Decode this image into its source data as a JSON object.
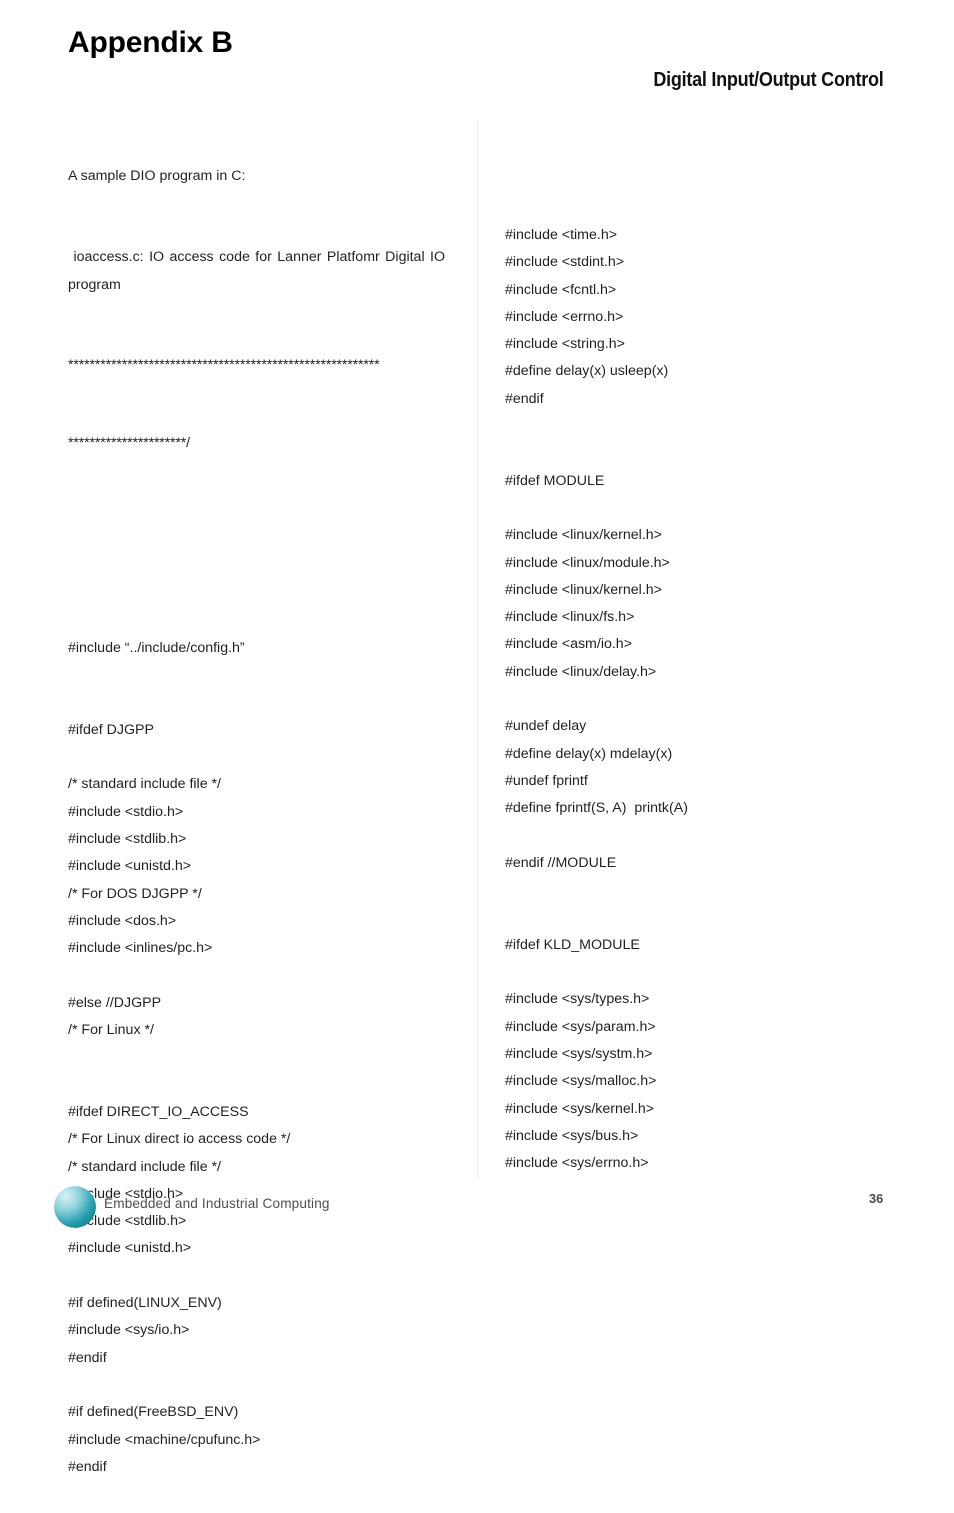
{
  "header": {
    "appendix_title": "Appendix B",
    "section_title": "Digital Input/Output Control"
  },
  "left_column": {
    "intro_line": "A sample DIO program in C:",
    "comment_line": " ioaccess.c: IO access code for Lanner Platfomr Digital IO program",
    "stars_line_1": "**********************************************************",
    "stars_line_2": "**********************/",
    "code_lines": [
      "#include “../include/config.h”",
      "",
      "",
      "#ifdef DJGPP",
      "",
      "/* standard include file */",
      "#include <stdio.h>",
      "#include <stdlib.h>",
      "#include <unistd.h>",
      "/* For DOS DJGPP */",
      "#include <dos.h>",
      "#include <inlines/pc.h>",
      "",
      "#else //DJGPP",
      "/* For Linux */",
      "",
      "",
      "#ifdef DIRECT_IO_ACCESS",
      "/* For Linux direct io access code */",
      "/* standard include file */",
      "#include <stdio.h>",
      "#include <stdlib.h>",
      "#include <unistd.h>",
      "",
      "#if defined(LINUX_ENV)",
      "#include <sys/io.h>",
      "#endif",
      "",
      "#if defined(FreeBSD_ENV)",
      "#include <machine/cpufunc.h>",
      "#endif"
    ]
  },
  "right_column": {
    "code_lines": [
      "#include <time.h>",
      "#include <stdint.h>",
      "#include <fcntl.h>",
      "#include <errno.h>",
      "#include <string.h>",
      "#define delay(x) usleep(x)",
      "#endif",
      "",
      "",
      "#ifdef MODULE",
      "",
      "#include <linux/kernel.h>",
      "#include <linux/module.h>",
      "#include <linux/kernel.h>",
      "#include <linux/fs.h>",
      "#include <asm/io.h>",
      "#include <linux/delay.h>",
      "",
      "#undef delay",
      "#define delay(x) mdelay(x)",
      "#undef fprintf",
      "#define fprintf(S, A)  printk(A)",
      "",
      "#endif //MODULE",
      "",
      "",
      "#ifdef KLD_MODULE",
      "",
      "#include <sys/types.h>",
      "#include <sys/param.h>",
      "#include <sys/systm.h>",
      "#include <sys/malloc.h>",
      "#include <sys/kernel.h>",
      "#include <sys/bus.h>",
      "#include <sys/errno.h>"
    ]
  },
  "footer": {
    "tagline": "Embedded and Industrial Computing",
    "page_number": "36",
    "logo_color_light": "#b8e4e8",
    "logo_color_dark": "#0e8a9a"
  }
}
